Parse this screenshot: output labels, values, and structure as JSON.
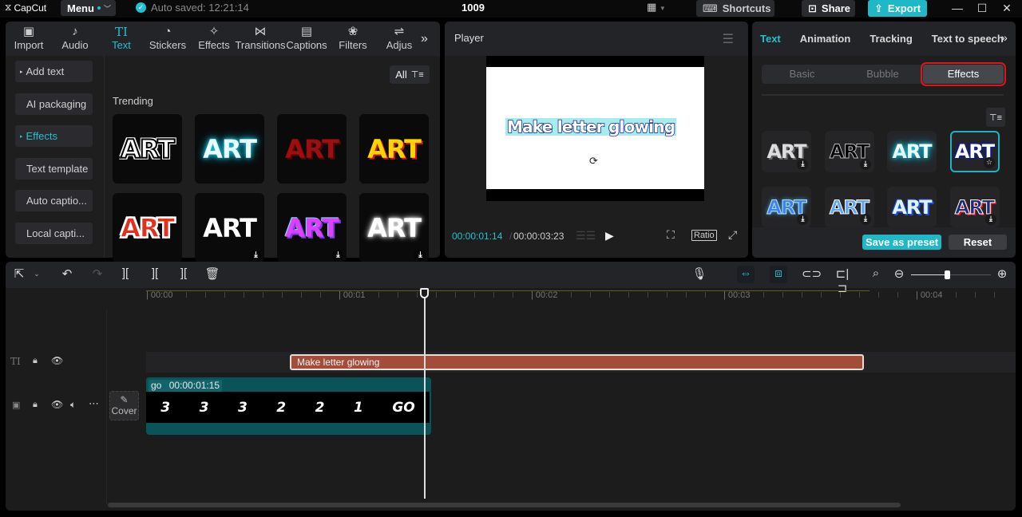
{
  "app": {
    "logo_text": "CapCut",
    "menu_label": "Menu",
    "auto_saved": "Auto saved: 12:21:14",
    "project_title": "1009",
    "shortcuts_label": "Shortcuts",
    "share_label": "Share",
    "export_label": "Export",
    "accent_color": "#22c0d0"
  },
  "media": {
    "tabs": [
      {
        "label": "Import",
        "icon": "import-icon"
      },
      {
        "label": "Audio",
        "icon": "audio-icon"
      },
      {
        "label": "Text",
        "icon": "text-icon",
        "active": true
      },
      {
        "label": "Stickers",
        "icon": "stickers-icon"
      },
      {
        "label": "Effects",
        "icon": "effects-icon"
      },
      {
        "label": "Transitions",
        "icon": "transitions-icon"
      },
      {
        "label": "Captions",
        "icon": "captions-icon"
      },
      {
        "label": "Filters",
        "icon": "filters-icon"
      },
      {
        "label": "Adjus",
        "icon": "adjust-icon"
      }
    ],
    "sidebar": [
      {
        "label": "Add text",
        "expandable": true
      },
      {
        "label": "AI packaging"
      },
      {
        "label": "Effects",
        "expandable": true,
        "active": true
      },
      {
        "label": "Text template"
      },
      {
        "label": "Auto captio..."
      },
      {
        "label": "Local capti..."
      }
    ],
    "filter_label": "All",
    "section_label": "Trending",
    "tile_text": "ART",
    "tiles": [
      {
        "style": "white-outline",
        "download": false
      },
      {
        "style": "cyan-glow",
        "download": false
      },
      {
        "style": "red-shadow",
        "download": false
      },
      {
        "style": "yellow-red",
        "download": false
      },
      {
        "style": "red-white",
        "download": false
      },
      {
        "style": "plain-white",
        "download": true
      },
      {
        "style": "purple-gradient",
        "download": true
      },
      {
        "style": "white-glow",
        "download": true
      }
    ]
  },
  "player": {
    "title": "Player",
    "caption_text": "Make letter glowing",
    "time_current": "00:00:01:14",
    "time_total": "00:00:03:23",
    "ratio_label": "Ratio"
  },
  "props": {
    "tabs": [
      {
        "label": "Text",
        "active": true
      },
      {
        "label": "Animation"
      },
      {
        "label": "Tracking"
      },
      {
        "label": "Text to speech"
      }
    ],
    "segments": [
      {
        "label": "Basic"
      },
      {
        "label": "Bubble"
      },
      {
        "label": "Effects",
        "active": true
      }
    ],
    "tile_text": "ART",
    "effects": [
      {
        "style": "gray-shadow",
        "badge": "download"
      },
      {
        "style": "black-outline",
        "badge": "download"
      },
      {
        "style": "cyan-glow",
        "badge": ""
      },
      {
        "style": "navy-blue",
        "badge": "favorite",
        "selected": true
      },
      {
        "style": "blue-glow",
        "badge": "download"
      },
      {
        "style": "split-blue",
        "badge": "download"
      },
      {
        "style": "light-blue",
        "badge": ""
      },
      {
        "style": "navy-red",
        "badge": "download"
      }
    ],
    "save_preset_label": "Save as preset",
    "reset_label": "Reset"
  },
  "timeline": {
    "ruler": [
      "00:00",
      "00:01",
      "00:02",
      "00:03",
      "00:04"
    ],
    "text_clip_label": "Make letter glowing",
    "video_clip_name": "go",
    "video_clip_duration": "00:00:01:15",
    "video_frames": [
      "3",
      "3",
      "3",
      "2",
      "2",
      "1",
      "GO"
    ],
    "cover_label": "Cover",
    "zoom_level": 0.45
  }
}
